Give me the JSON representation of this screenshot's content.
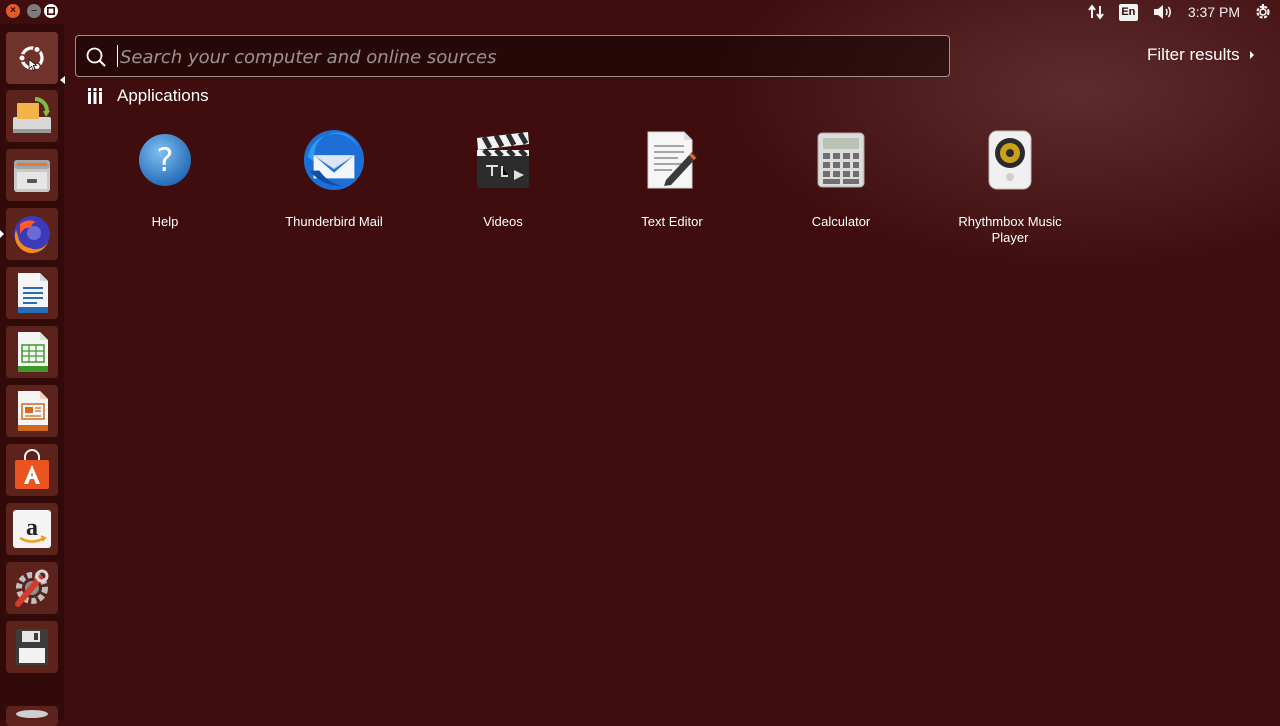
{
  "top_panel": {
    "window_buttons": [
      "close-icon",
      "minimize-icon",
      "maximize-icon"
    ],
    "indicators": {
      "network_icon": "network-updown-icon",
      "keyboard_layout": "En",
      "sound_icon": "speaker-icon",
      "clock": "3:37 PM",
      "session_icon": "gear-power-icon"
    }
  },
  "launcher": {
    "items": [
      {
        "name": "dash-home",
        "icon": "ubuntu-logo-icon"
      },
      {
        "name": "software-updater",
        "icon": "software-updater-icon"
      },
      {
        "name": "files",
        "icon": "file-cabinet-icon"
      },
      {
        "name": "firefox",
        "icon": "firefox-icon"
      },
      {
        "name": "libreoffice-writer",
        "icon": "writer-document-icon"
      },
      {
        "name": "libreoffice-calc",
        "icon": "calc-spreadsheet-icon"
      },
      {
        "name": "libreoffice-impress",
        "icon": "impress-presentation-icon"
      },
      {
        "name": "ubuntu-software",
        "icon": "shopping-bag-icon"
      },
      {
        "name": "amazon",
        "icon": "amazon-icon"
      },
      {
        "name": "system-settings",
        "icon": "settings-wrench-icon"
      },
      {
        "name": "save-drive",
        "icon": "floppy-icon"
      },
      {
        "name": "trash",
        "icon": "trash-icon"
      }
    ]
  },
  "search": {
    "placeholder": "Search your computer and online sources",
    "value": ""
  },
  "filter": {
    "label": "Filter results"
  },
  "category": {
    "title": "Applications",
    "icon": "applications-grid-icon"
  },
  "apps": [
    {
      "label": "Help",
      "icon": "help-icon"
    },
    {
      "label": "Thunderbird Mail",
      "icon": "thunderbird-icon"
    },
    {
      "label": "Videos",
      "icon": "clapperboard-icon"
    },
    {
      "label": "Text Editor",
      "icon": "text-editor-icon"
    },
    {
      "label": "Calculator",
      "icon": "calculator-icon"
    },
    {
      "label": "Rhythmbox Music Player",
      "icon": "rhythmbox-speaker-icon"
    }
  ],
  "colors": {
    "background": "#3f0d0d",
    "accent_orange": "#e25a2e"
  }
}
